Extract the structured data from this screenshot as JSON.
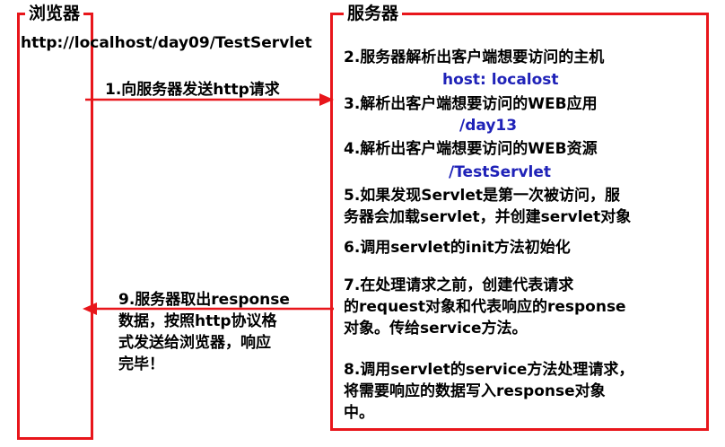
{
  "browser": {
    "title": "浏览器",
    "url": "http://localhost/day09/TestServlet"
  },
  "server": {
    "title": "服务器"
  },
  "arrows": {
    "request_label": "1.向服务器发送http请求",
    "response_lines": [
      "9.服务器取出response",
      "数据，按照http协议格",
      "式发送给浏览器，响应",
      "完毕！"
    ]
  },
  "steps": {
    "s2": "2.服务器解析出客户端想要访问的主机",
    "s2_value": "host: localost",
    "s3": "3.解析出客户端想要访问的WEB应用",
    "s3_value": "/day13",
    "s4": "4.解析出客户端想要访问的WEB资源",
    "s4_value": "/TestServlet",
    "s5_lines": [
      "5.如果发现Servlet是第一次被访问，服",
      "务器会加载servlet，并创建servlet对象"
    ],
    "s6": "6.调用servlet的init方法初始化",
    "s7_lines": [
      "7.在处理请求之前，创建代表请求",
      "的request对象和代表响应的response",
      "对象。传给service方法。"
    ],
    "s8_lines": [
      "8.调用servlet的service方法处理请求，",
      "将需要响应的数据写入response对象",
      "中。"
    ]
  },
  "colors": {
    "border": "#e8161b",
    "arrow": "#e8161b",
    "value_text": "#1f22b8"
  }
}
